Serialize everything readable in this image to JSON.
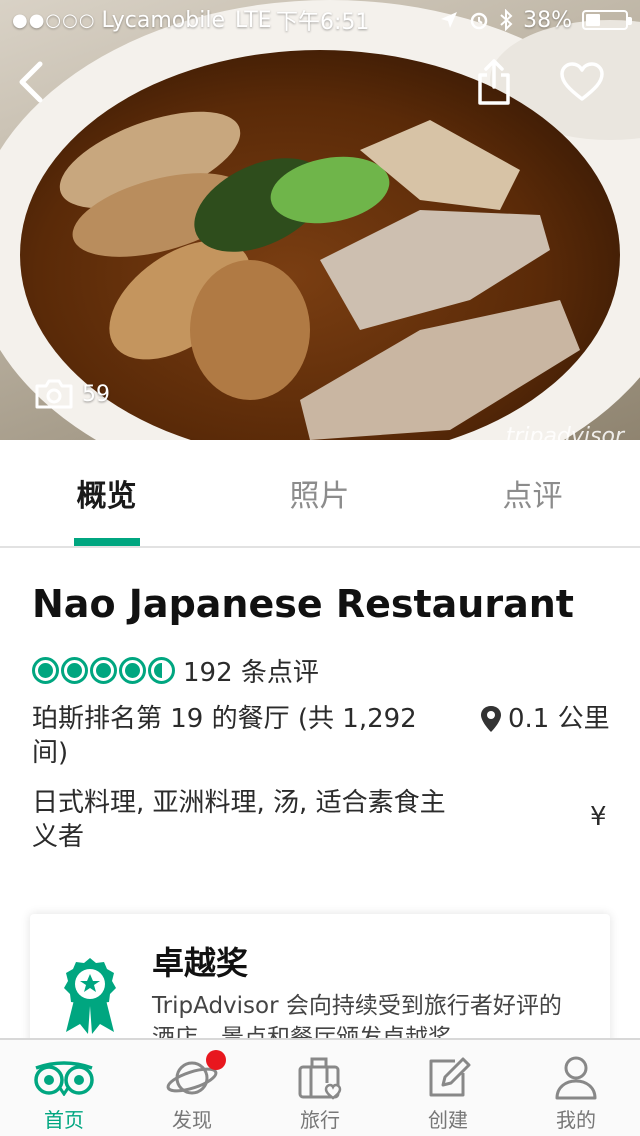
{
  "status_bar": {
    "signal": "●●○○○",
    "carrier": "Lycamobile",
    "network": "LTE",
    "time": "下午6:51",
    "battery": "38%",
    "battery_level": 0.38
  },
  "hero": {
    "photo_count": "59",
    "watermark": "tripadvisor"
  },
  "tabs": [
    {
      "label": "概览",
      "active": true
    },
    {
      "label": "照片",
      "active": false
    },
    {
      "label": "点评",
      "active": false
    }
  ],
  "restaurant": {
    "name": "Nao Japanese Restaurant",
    "rating": 4.5,
    "reviews": "192 条点评",
    "rank": "珀斯排名第 19 的餐厅 (共 1,292 间)",
    "distance": "0.1 公里",
    "cuisines": "日式料理, 亚洲料理, 汤, 适合素食主义者",
    "price": "¥"
  },
  "award": {
    "title": "卓越奖",
    "description": "TripAdvisor 会向持续受到旅行者好评的酒店、景点和餐厅颁发卓越奖"
  },
  "colors": {
    "accent": "#00a680",
    "badge": "#e8171e"
  },
  "bottom_nav": [
    {
      "label": "首页",
      "icon": "owl-icon",
      "active": true
    },
    {
      "label": "发现",
      "icon": "planet-icon",
      "active": false
    },
    {
      "label": "旅行",
      "icon": "suitcase-heart-icon",
      "active": false
    },
    {
      "label": "创建",
      "icon": "edit-icon",
      "active": false
    },
    {
      "label": "我的",
      "icon": "person-icon",
      "active": false
    }
  ]
}
